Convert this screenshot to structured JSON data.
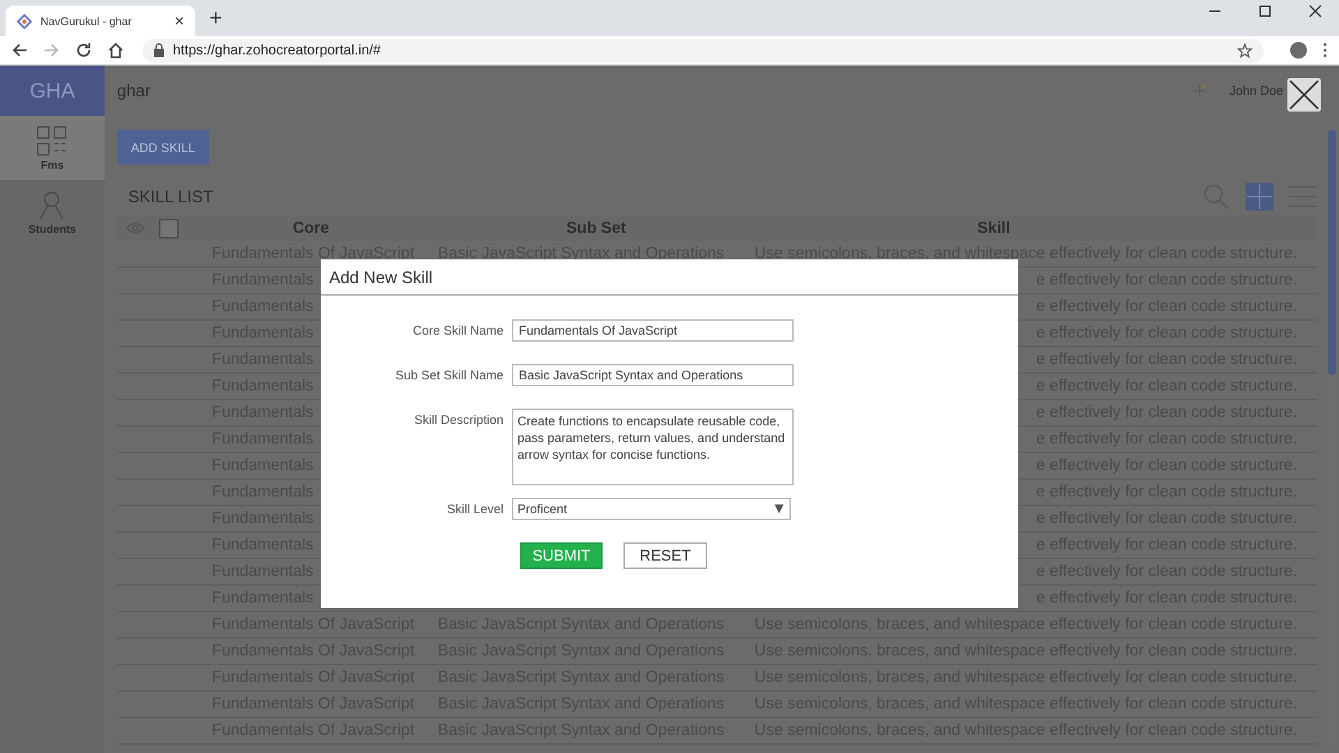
{
  "browser": {
    "tab_title": "NavGurukul - ghar",
    "tab_close": "×",
    "new_tab": "+",
    "url": "https://ghar.zohocreatorportal.in/#"
  },
  "app": {
    "logo": "GHA",
    "app_name": "ghar",
    "user": "John Doe",
    "sidebar": [
      {
        "label": "Fms",
        "selected": true
      },
      {
        "label": "Students",
        "selected": false
      }
    ],
    "add_button": "ADD SKILL",
    "list_title": "SKILL LIST",
    "select_all": {
      "checked": false
    },
    "columns": [
      "Core",
      "Sub Set",
      "Skill"
    ],
    "rows": [
      {
        "core": "Fundamentals Of JavaScript",
        "sub_set": "Basic JavaScript Syntax and Operations",
        "skill": "Use semicolons, braces, and whitespace effectively for clean code structure."
      },
      {
        "core": "Fundamentals",
        "skill": "e effectively for clean code structure."
      },
      {
        "core": "Fundamentals",
        "skill": "e effectively for clean code structure."
      },
      {
        "core": "Fundamentals",
        "skill": "e effectively for clean code structure."
      },
      {
        "core": "Fundamentals",
        "skill": "e effectively for clean code structure."
      },
      {
        "core": "Fundamentals",
        "skill": "e effectively for clean code structure."
      },
      {
        "core": "Fundamentals",
        "skill": "e effectively for clean code structure."
      },
      {
        "core": "Fundamentals",
        "skill": "e effectively for clean code structure."
      },
      {
        "core": "Fundamentals",
        "skill": "e effectively for clean code structure."
      },
      {
        "core": "Fundamentals",
        "skill": "e effectively for clean code structure."
      },
      {
        "core": "Fundamentals",
        "skill": "e effectively for clean code structure."
      },
      {
        "core": "Fundamentals",
        "skill": "e effectively for clean code structure."
      },
      {
        "core": "Fundamentals",
        "skill": "e effectively for clean code structure."
      },
      {
        "core": "Fundamentals",
        "skill": "e effectively for clean code structure."
      },
      {
        "core": "Fundamentals Of JavaScript",
        "sub_set": "Basic JavaScript Syntax and Operations",
        "skill": "Use semicolons, braces, and whitespace effectively for clean code structure."
      },
      {
        "core": "Fundamentals Of JavaScript",
        "sub_set": "Basic JavaScript Syntax and Operations",
        "skill": "Use semicolons, braces, and whitespace effectively for clean code structure."
      },
      {
        "core": "Fundamentals Of JavaScript",
        "sub_set": "Basic JavaScript Syntax and Operations",
        "skill": "Use semicolons, braces, and whitespace effectively for clean code structure."
      },
      {
        "core": "Fundamentals Of JavaScript",
        "sub_set": "Basic JavaScript Syntax and Operations",
        "skill": "Use semicolons, braces, and whitespace effectively for clean code structure."
      },
      {
        "core": "Fundamentals Of JavaScript",
        "sub_set": "Basic JavaScript Syntax and Operations",
        "skill": "Use semicolons, braces, and whitespace effectively for clean code structure."
      }
    ]
  },
  "dialog": {
    "title": "Add New Skill",
    "fields": [
      {
        "kind": "text",
        "label": "Core Skill Name",
        "value": "Fundamentals Of JavaScript"
      },
      {
        "kind": "text",
        "label": "Sub Set Skill Name",
        "value": "Basic JavaScript Syntax and Operations"
      },
      {
        "kind": "textarea",
        "label": "Skill Description",
        "value": "Create functions to encapsulate reusable code, pass parameters, return values, and understand arrow syntax for concise functions."
      },
      {
        "kind": "select",
        "label": "Skill Level",
        "value": "Proficent",
        "caret": "▼"
      }
    ],
    "buttons": [
      {
        "kind": "primary",
        "label": "SUBMIT"
      },
      {
        "kind": "secondary",
        "label": "RESET"
      }
    ]
  }
}
